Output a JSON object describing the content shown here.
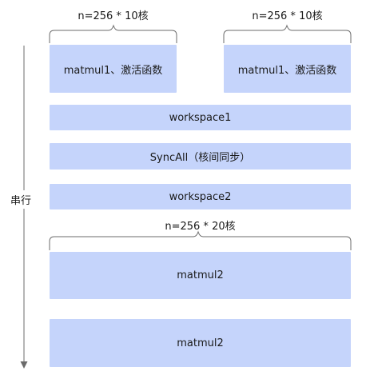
{
  "braces": {
    "left_top": "n=256 * 10核",
    "right_top": "n=256 * 10核",
    "bottom": "n=256 * 20核"
  },
  "boxes": {
    "matmul1_left": "matmul1、激活函数",
    "matmul1_right": "matmul1、激活函数",
    "workspace1": "workspace1",
    "syncall": "SyncAll（核间同步）",
    "workspace2": "workspace2",
    "matmul2_a": "matmul2",
    "matmul2_b": "matmul2"
  },
  "timeline": {
    "label": "串行"
  },
  "colors": {
    "box_fill": "#c5d4fb",
    "line": "#6b6b6b"
  }
}
